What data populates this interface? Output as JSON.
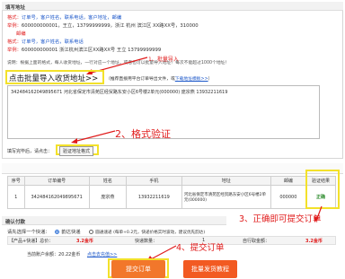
{
  "header": {
    "title": "填写地址"
  },
  "format": {
    "label1": "格式：",
    "fields1": "订单号，客户姓名，联系电话，客户地址，邮编",
    "example1_label": "举例：",
    "example1": "600000000001，王立，13799999999，浙江 杭州 滨江区 XX路XX号，310000",
    "note1": "邮编",
    "label2": "格式：",
    "fields2": "订单号，客户姓名，联系电话",
    "example2_label": "举例：",
    "example2": "600000000001 浙江杭州滨江区XX路XX号 王立 13799999999",
    "tip": "说明：根据上面的格式，每人收货地址，一行对应一个地址，或者也可以批量导入地址！每次不能超过1000个地址！"
  },
  "annotations": {
    "step1": "1、批量导入",
    "step2": "2、格式验证",
    "step3": "3、正确即可提交订单",
    "step4": "4、提交订单"
  },
  "import": {
    "link": "点击批量导入收货地址>>",
    "hint": "（推荐直接用平台订单导出文件，或",
    "template_link": "下载地址模板>>",
    "hint_end": "）"
  },
  "textarea": {
    "value": "342484162049895671  河北省保定市清苑区经贸路东安小区6号楼2单元(000000)   庞宗燕   13932211619"
  },
  "verify": {
    "label": "填写完毕后，请点击：",
    "button": "验证地址格式"
  },
  "table": {
    "headers": [
      "序号",
      "订单编号",
      "姓名",
      "手机",
      "地址",
      "邮编",
      "验证结果"
    ],
    "rows": [
      [
        "1",
        "342484162049895671",
        "庞宗燕",
        "13932211619",
        "河北省保定市清苑区经贸路东安小区6号楼2单元(000000)",
        "000000",
        "正确"
      ]
    ]
  },
  "confirm": {
    "title": "确认付款",
    "ship_label": "请先选择一个快递：",
    "option1": "韵达快递",
    "option2": "圆通速递 (每单+0.2元，快递价格实时波动，建议优先韵达)",
    "price_label": "【产品+快递】总价：",
    "price": "3.2金币",
    "count_label": "快递数量：",
    "count": "1",
    "total_label": "自行取金额：",
    "total": "3.2金币",
    "balance_label": "当前账户余额：",
    "balance": "20.22金币",
    "recharge": "点击去充值>>"
  },
  "buttons": {
    "submit": "提交订单",
    "batch": "批量发货教程"
  },
  "colors": {
    "red": "#e01b1b",
    "blue": "#1a56c9",
    "yellow": "#f3e12a",
    "submit_bg": "#f2772b",
    "batch_bg": "#f25a22",
    "green": "#2a8a2a"
  }
}
